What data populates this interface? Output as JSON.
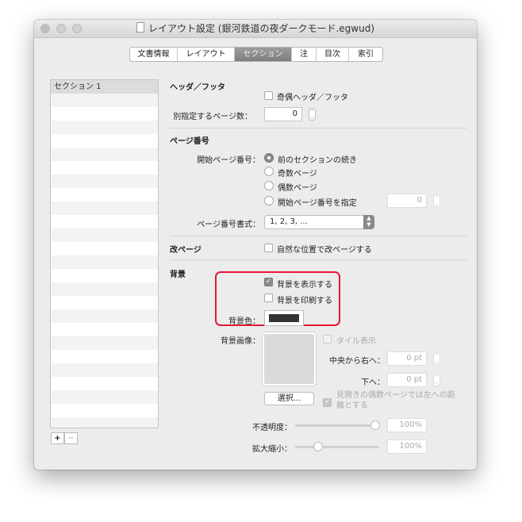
{
  "window": {
    "title": "レイアウト設定 (銀河鉄道の夜ダークモード.egwud)"
  },
  "tabs": [
    {
      "label": "文書情報"
    },
    {
      "label": "レイアウト"
    },
    {
      "label": "セクション"
    },
    {
      "label": "注"
    },
    {
      "label": "目次"
    },
    {
      "label": "索引"
    }
  ],
  "sections": {
    "items": [
      "セクション 1"
    ],
    "add": "+",
    "remove": "−"
  },
  "header_footer": {
    "title": "ヘッダ／フッタ",
    "odd_even": "奇偶ヘッダ／フッタ",
    "odd_even_checked": false,
    "separate_pages_label": "別指定するページ数：",
    "separate_pages_value": "0"
  },
  "page_number": {
    "title": "ページ番号",
    "start_label": "開始ページ番号：",
    "options": [
      "前のセクションの続き",
      "奇数ページ",
      "偶数ページ",
      "開始ページ番号を指定"
    ],
    "selected": 0,
    "start_value": "0",
    "format_label": "ページ番号書式：",
    "format_value": "1, 2, 3, ..."
  },
  "page_break": {
    "title": "改ページ",
    "natural": "自然な位置で改ページする",
    "checked": false
  },
  "background": {
    "title": "背景",
    "show": "背景を表示する",
    "show_checked": true,
    "print": "背景を印刷する",
    "print_checked": false,
    "color_label": "背景色：",
    "color": "#333333",
    "image_label": "背景画像：",
    "tile": "タイル表示",
    "offset_right_label": "中央から右へ：",
    "offset_right": "0 pt",
    "offset_down_label": "下へ：",
    "offset_down": "0 pt",
    "choose": "選択...",
    "mirror": "見開きの偶数ページでは左への距離とする",
    "mirror_checked": true,
    "opacity_label": "不透明度：",
    "opacity": "100%",
    "opacity_value": 1.0,
    "scale_label": "拡大縮小：",
    "scale": "100%",
    "scale_value": 0.25
  }
}
